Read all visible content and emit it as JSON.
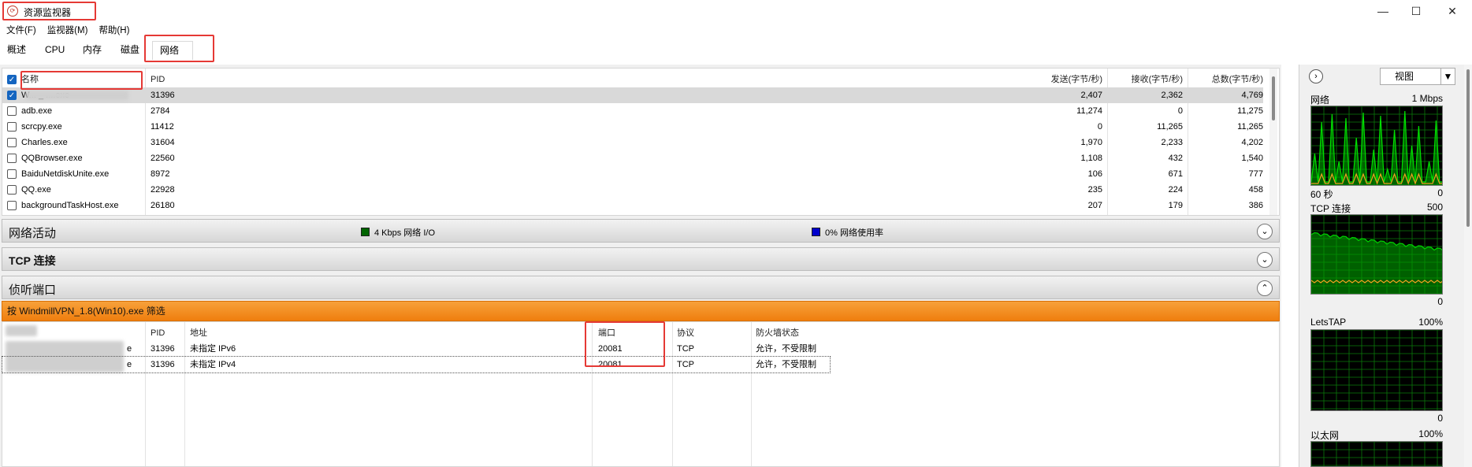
{
  "window": {
    "title": "资源监视器",
    "minimize_icon": "minimize-icon",
    "maximize_icon": "maximize-icon",
    "close_icon": "close-icon"
  },
  "menu": [
    "文件(F)",
    "监视器(M)",
    "帮助(H)"
  ],
  "tabs": [
    "概述",
    "CPU",
    "内存",
    "磁盘",
    "网络"
  ],
  "active_tab": "网络",
  "processes": {
    "headers": {
      "name": "名称",
      "pid": "PID",
      "send": "发送(字节/秒)",
      "recv": "接收(字节/秒)",
      "total": "总数(字节/秒)"
    },
    "rows": [
      {
        "name": "W... _ ....exe",
        "pid": "31396",
        "send": "2,407",
        "recv": "2,362",
        "total": "4,769",
        "checked": true
      },
      {
        "name": "adb.exe",
        "pid": "2784",
        "send": "11,274",
        "recv": "0",
        "total": "11,275",
        "checked": false
      },
      {
        "name": "scrcpy.exe",
        "pid": "11412",
        "send": "0",
        "recv": "11,265",
        "total": "11,265",
        "checked": false
      },
      {
        "name": "Charles.exe",
        "pid": "31604",
        "send": "1,970",
        "recv": "2,233",
        "total": "4,202",
        "checked": false
      },
      {
        "name": "QQBrowser.exe",
        "pid": "22560",
        "send": "1,108",
        "recv": "432",
        "total": "1,540",
        "checked": false
      },
      {
        "name": "BaiduNetdiskUnite.exe",
        "pid": "8972",
        "send": "106",
        "recv": "671",
        "total": "777",
        "checked": false
      },
      {
        "name": "QQ.exe",
        "pid": "22928",
        "send": "235",
        "recv": "224",
        "total": "458",
        "checked": false
      },
      {
        "name": "backgroundTaskHost.exe",
        "pid": "26180",
        "send": "207",
        "recv": "179",
        "total": "386",
        "checked": false
      }
    ]
  },
  "sections": {
    "network_activity": {
      "title": "网络活动",
      "io_label": "4 Kbps 网络 I/O",
      "io_color": "#006400",
      "usage_label": "0% 网络使用率",
      "usage_color": "#0000cc"
    },
    "tcp": {
      "title": "TCP 连接"
    },
    "listening": {
      "title": "侦听端口"
    }
  },
  "filter_text": "按 WindmillVPN_1.8(Win10).exe 筛选",
  "ports": {
    "headers": {
      "name": "名称",
      "pid": "PID",
      "address": "地址",
      "port": "端口",
      "protocol": "协议",
      "firewall": "防火墙状态"
    },
    "rows": [
      {
        "name_suffix": "e",
        "pid": "31396",
        "address": "未指定 IPv6",
        "port": "20081",
        "protocol": "TCP",
        "firewall": "允许，不受限制"
      },
      {
        "name_suffix": "e",
        "pid": "31396",
        "address": "未指定 IPv4",
        "port": "20081",
        "protocol": "TCP",
        "firewall": "允许，不受限制"
      }
    ]
  },
  "side_panel": {
    "view_button": "视图",
    "graphs": [
      {
        "title": "网络",
        "value": "1 Mbps",
        "bottom_left": "60 秒",
        "bottom_right": "0"
      },
      {
        "title": "TCP 连接",
        "value": "500",
        "bottom_right": "0"
      },
      {
        "title": "LetsTAP",
        "value": "100%",
        "bottom_right": "0"
      },
      {
        "title": "以太网",
        "value": "100%"
      }
    ]
  }
}
